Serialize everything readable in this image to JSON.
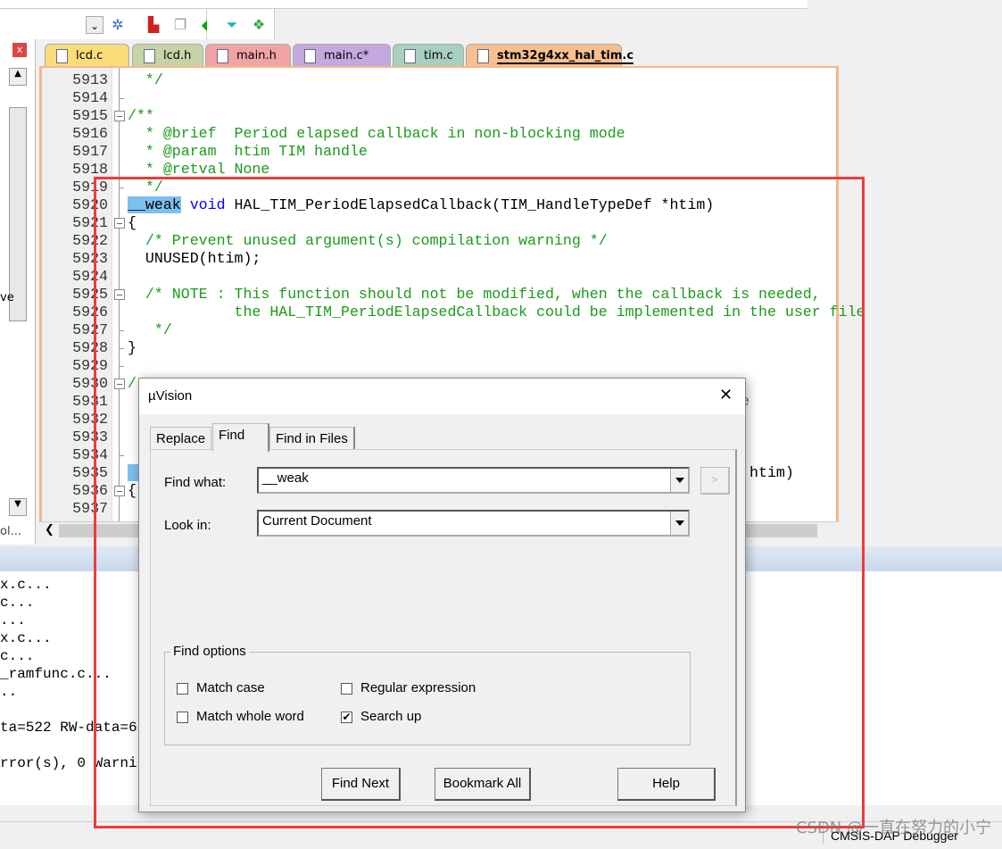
{
  "toolbar": {
    "icons": [
      "dropdown-icon",
      "wizard-icon",
      "manage-run-time-icon",
      "copy-icon",
      "diamond-icon",
      "filter-icon",
      "multi-project-icon"
    ]
  },
  "left_pane": {
    "close_label": "x",
    "fragment_text": "ve",
    "bottom_tab": "ol..."
  },
  "tabs": [
    {
      "label": "lcd.c",
      "color": "#fbdc7a",
      "active": false
    },
    {
      "label": "lcd.h",
      "color": "#c5d4a6",
      "active": false
    },
    {
      "label": "main.h",
      "color": "#f0a4a4",
      "active": false
    },
    {
      "label": "main.c*",
      "color": "#c4a8e0",
      "active": false
    },
    {
      "label": "tim.c",
      "color": "#a8cfc0",
      "active": false
    },
    {
      "label": "stm32g4xx_hal_tim.c",
      "color": "#f8bf90",
      "active": true
    }
  ],
  "editor": {
    "lines": [
      {
        "n": "5913",
        "fold": "line",
        "segs": [
          {
            "t": "  */",
            "c": "comment"
          }
        ]
      },
      {
        "n": "5914",
        "fold": "tick",
        "segs": []
      },
      {
        "n": "5915",
        "fold": "box",
        "segs": [
          {
            "t": "/**",
            "c": "comment"
          }
        ]
      },
      {
        "n": "5916",
        "fold": "line",
        "segs": [
          {
            "t": "  * @brief  Period elapsed callback in non-blocking mode",
            "c": "comment"
          }
        ]
      },
      {
        "n": "5917",
        "fold": "line",
        "segs": [
          {
            "t": "  * @param  htim TIM handle",
            "c": "comment"
          }
        ]
      },
      {
        "n": "5918",
        "fold": "line",
        "segs": [
          {
            "t": "  * @retval None",
            "c": "comment"
          }
        ]
      },
      {
        "n": "5919",
        "fold": "tick",
        "segs": [
          {
            "t": "  */",
            "c": "comment"
          }
        ]
      },
      {
        "n": "5920",
        "fold": "line",
        "segs": [
          {
            "t": "__weak",
            "c": "hl"
          },
          {
            "t": " void",
            "c": "kw"
          },
          {
            "t": " HAL_TIM_PeriodElapsedCallback(TIM_HandleTypeDef *htim)",
            "c": "plain"
          }
        ]
      },
      {
        "n": "5921",
        "fold": "box",
        "segs": [
          {
            "t": "{",
            "c": "plain"
          }
        ]
      },
      {
        "n": "5922",
        "fold": "line",
        "segs": [
          {
            "t": "  /* Prevent unused argument(s) compilation warning */",
            "c": "comment"
          }
        ]
      },
      {
        "n": "5923",
        "fold": "line",
        "segs": [
          {
            "t": "  UNUSED(htim);",
            "c": "plain"
          }
        ]
      },
      {
        "n": "5924",
        "fold": "line",
        "segs": []
      },
      {
        "n": "5925",
        "fold": "box",
        "segs": [
          {
            "t": "  /* NOTE : This function should not be modified, when the callback is needed,",
            "c": "comment"
          }
        ]
      },
      {
        "n": "5926",
        "fold": "line",
        "segs": [
          {
            "t": "            the HAL_TIM_PeriodElapsedCallback could be implemented in the user file",
            "c": "comment"
          }
        ]
      },
      {
        "n": "5927",
        "fold": "tick",
        "segs": [
          {
            "t": "   */",
            "c": "comment"
          }
        ]
      },
      {
        "n": "5928",
        "fold": "tick",
        "segs": [
          {
            "t": "}",
            "c": "plain"
          }
        ]
      },
      {
        "n": "5929",
        "fold": "tick",
        "segs": []
      },
      {
        "n": "5930",
        "fold": "box",
        "segs": [
          {
            "t": "/",
            "c": "comment"
          }
        ]
      },
      {
        "n": "5931",
        "fold": "line",
        "segs": [
          {
            "t": "                                                                     e",
            "c": "comment"
          }
        ]
      },
      {
        "n": "5932",
        "fold": "line",
        "segs": []
      },
      {
        "n": "5933",
        "fold": "line",
        "segs": []
      },
      {
        "n": "5934",
        "fold": "tick",
        "segs": []
      },
      {
        "n": "5935",
        "fold": "line",
        "segs": [
          {
            "t": "      ",
            "c": "hl"
          },
          {
            "t": "                                                                htim)",
            "c": "plain"
          }
        ]
      },
      {
        "n": "5936",
        "fold": "box",
        "segs": [
          {
            "t": "{",
            "c": "plain"
          }
        ]
      },
      {
        "n": "5937",
        "fold": "line",
        "segs": []
      }
    ]
  },
  "output": {
    "lines": [
      "x.c...",
      "c...",
      "...",
      "x.c...",
      "c...",
      "_ramfunc.c...",
      "..",
      "",
      "ta=522 RW-data=6",
      "",
      "rror(s), 0 Warni"
    ]
  },
  "status": {
    "debugger": "CMSIS-DAP Debugger"
  },
  "watermark": "CSDN @一直在努力的小宁",
  "dialog": {
    "title": "µVision",
    "close_label": "✕",
    "tabs": [
      {
        "label": "Replace",
        "active": false
      },
      {
        "label": "Find",
        "active": true
      },
      {
        "label": "Find in Files",
        "active": false
      }
    ],
    "find_what_label": "Find what:",
    "find_what_value": "__weak",
    "look_in_label": "Look in:",
    "look_in_value": "Current Document",
    "history_button": ">",
    "options_title": "Find options",
    "options": [
      {
        "label": "Match case",
        "checked": false
      },
      {
        "label": "Match whole word",
        "checked": false
      },
      {
        "label": "Regular expression",
        "checked": false
      },
      {
        "label": "Search up",
        "checked": true
      }
    ],
    "buttons": {
      "find_next": "Find Next",
      "bookmark_all": "Bookmark All",
      "help": "Help"
    }
  },
  "colors": {
    "highlight_box": "#ee3b3b",
    "comment": "#1a9b1a",
    "keyword": "#0000ff",
    "selection": "#7dc0f0"
  }
}
